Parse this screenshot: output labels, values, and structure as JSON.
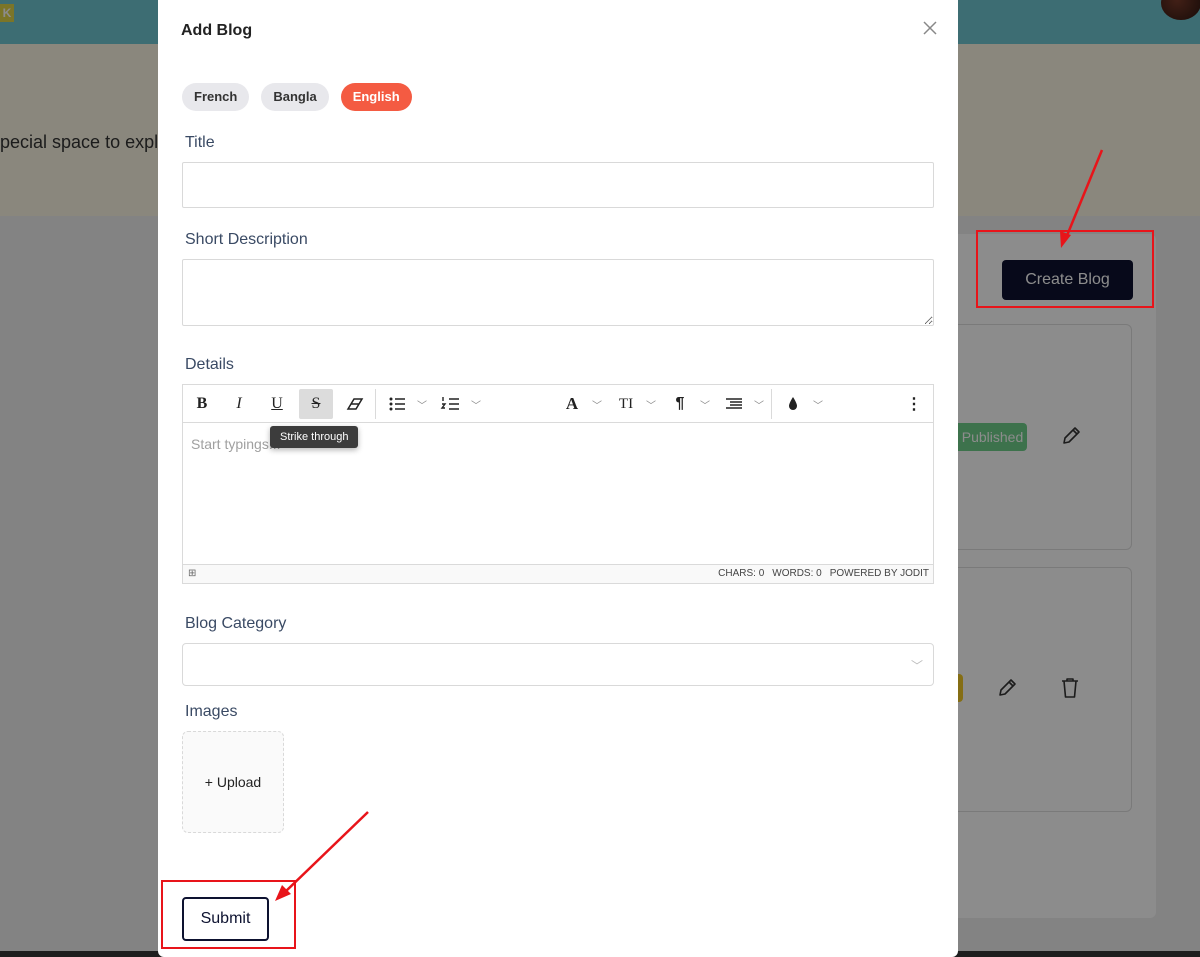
{
  "background": {
    "logo_letter": "K",
    "hero_text": "pecial space to explor",
    "create_button": "Create Blog",
    "published_badge": "Published",
    "icons": [
      "pencil-icon",
      "pencil-icon",
      "trash-icon"
    ]
  },
  "modal": {
    "title": "Add Blog",
    "close_icon": "close-icon",
    "languages": [
      {
        "label": "French",
        "active": false
      },
      {
        "label": "Bangla",
        "active": false
      },
      {
        "label": "English",
        "active": true
      }
    ],
    "fields": {
      "title_label": "Title",
      "title_value": "",
      "short_description_label": "Short Description",
      "short_description_value": "",
      "details_label": "Details",
      "category_label": "Blog Category",
      "category_value": "",
      "images_label": "Images"
    },
    "editor": {
      "toolbar": [
        {
          "name": "bold-icon",
          "glyph": "B"
        },
        {
          "name": "italic-icon",
          "glyph": "I"
        },
        {
          "name": "underline-icon",
          "glyph": "U"
        },
        {
          "name": "strikethrough-icon",
          "glyph": "S",
          "active": true
        },
        {
          "name": "eraser-icon",
          "glyph": "⌫"
        },
        {
          "name": "bullet-list-icon",
          "glyph": "☰"
        },
        {
          "name": "numbered-list-icon",
          "glyph": "☰"
        },
        {
          "name": "font-icon",
          "glyph": "A"
        },
        {
          "name": "font-size-icon",
          "glyph": "TI"
        },
        {
          "name": "paragraph-icon",
          "glyph": "¶"
        },
        {
          "name": "line-height-icon",
          "glyph": "☰"
        },
        {
          "name": "color-drop-icon",
          "glyph": "●"
        },
        {
          "name": "more-vertical-icon",
          "glyph": "⋮"
        }
      ],
      "placeholder": "Start typings...",
      "tooltip": "Strike through",
      "status": {
        "chars": "CHARS: 0",
        "words": "WORDS: 0",
        "powered_by": "POWERED BY JODIT"
      }
    },
    "upload_label": "+ Upload",
    "submit_label": "Submit"
  },
  "accent_colors": {
    "primary_dark": "#0d1230",
    "language_active": "#f45b42",
    "header_teal": "#70c6d2",
    "annotation_red": "#e8141a"
  }
}
